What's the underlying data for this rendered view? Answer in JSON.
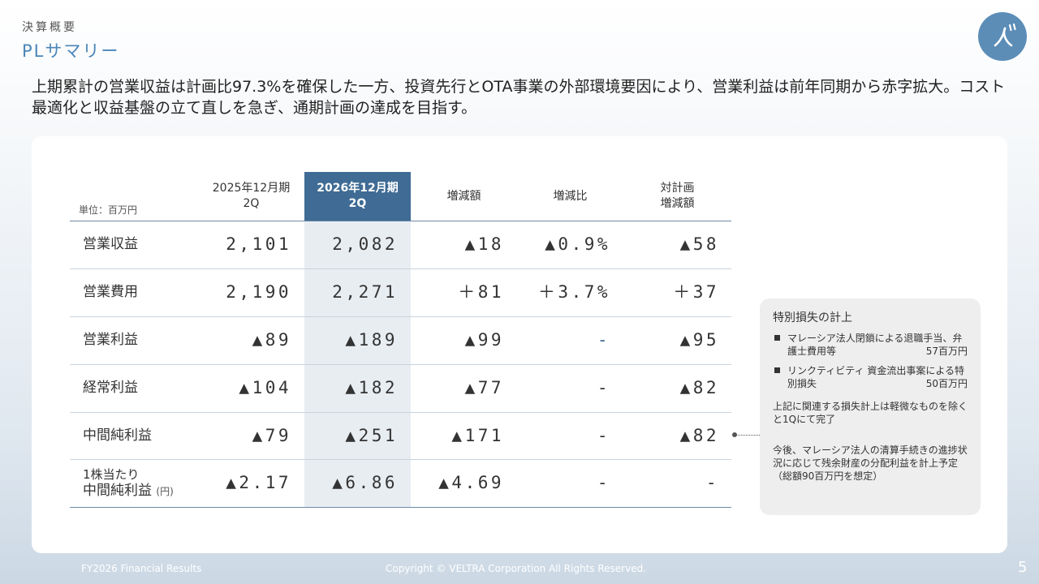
{
  "header": {
    "section": "決算概要",
    "title": "PLサマリー",
    "logo_glyph": "ン\""
  },
  "lead": "上期累計の営業収益は計画比97.3%を確保した一方、投資先行とOTA事業の外部環境要因により、営業利益は前年同期から赤字拡大。コスト最適化と収益基盤の立て直しを急ぎ、通期計画の達成を目指す。",
  "table": {
    "unit": "単位：百万円",
    "columns": [
      "2025年12月期\n2Q",
      "2026年12月期\n2Q",
      "増減額",
      "増減比",
      "対計画\n増減額"
    ],
    "rows": [
      {
        "label": "営業収益",
        "values": [
          "2,101",
          "2,082",
          "▲18",
          "▲0.9%",
          "▲58"
        ]
      },
      {
        "label": "営業費用",
        "values": [
          "2,190",
          "2,271",
          "＋81",
          "＋3.7%",
          "＋37"
        ]
      },
      {
        "label": "営業利益",
        "values": [
          "▲89",
          "▲189",
          "▲99",
          "-",
          "▲95"
        ]
      },
      {
        "label": "経常利益",
        "values": [
          "▲104",
          "▲182",
          "▲77",
          "-",
          "▲82"
        ]
      },
      {
        "label": "中間純利益",
        "values": [
          "▲79",
          "▲251",
          "▲171",
          "-",
          "▲82"
        ]
      },
      {
        "label_line1": "1株当たり",
        "label_line2": "中間純利益",
        "label_unit": "(円)",
        "values": [
          "▲2.17",
          "▲6.86",
          "▲4.69",
          "-",
          "-"
        ]
      }
    ]
  },
  "notes": {
    "title": "特別損失の計上",
    "items": [
      {
        "text": "マレーシア法人閉鎖による退職手当、弁護士費用等",
        "amount": "57百万円"
      },
      {
        "text": "リンクティビティ 資金流出事案による特別損失",
        "amount": "50百万円"
      }
    ],
    "text1": "上記に関連する損失計上は軽微なものを除くと1Qにて完了",
    "text2": "今後、マレーシア法人の清算手続きの進捗状況に応じて残余財産の分配利益を計上予定（総額90百万円を想定）"
  },
  "footer": {
    "left": "FY2026 Financial Results",
    "center": "Copyright © VELTRA Corporation All Rights Reserved.",
    "page": "5"
  },
  "colors": {
    "accent": "#4a86b8",
    "highlight_header": "#3f6b94",
    "highlight_column": "#e8edf2"
  }
}
